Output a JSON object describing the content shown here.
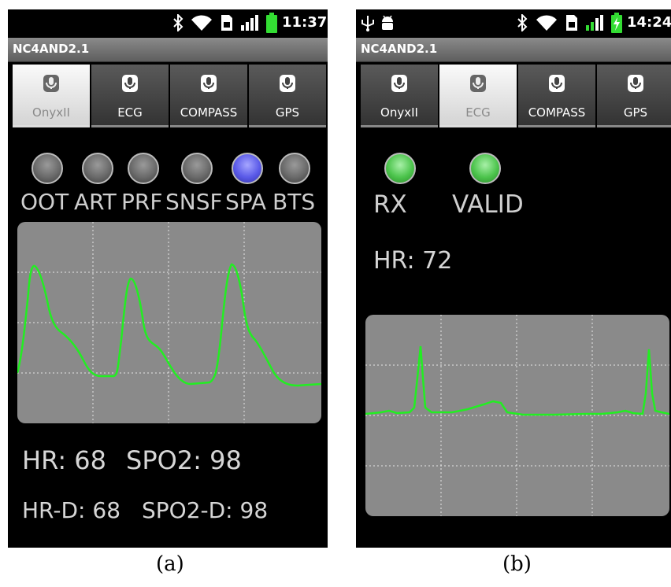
{
  "panel_a": {
    "status": {
      "time": "11:37"
    },
    "app_title": "NC4AND2.1",
    "tabs": [
      {
        "label": "OnyxII",
        "selected": true
      },
      {
        "label": "ECG",
        "selected": false
      },
      {
        "label": "COMPASS",
        "selected": false
      },
      {
        "label": "GPS",
        "selected": false
      }
    ],
    "indicators": [
      {
        "label": "OOT",
        "state": "off"
      },
      {
        "label": "ART",
        "state": "off"
      },
      {
        "label": "PRF",
        "state": "off"
      },
      {
        "label": "SNSF",
        "state": "off"
      },
      {
        "label": "SPA",
        "state": "on"
      },
      {
        "label": "BTS",
        "state": "off"
      }
    ],
    "hr": "HR: 68",
    "spo2": "SPO2: 98",
    "hr_d": "HR-D: 68",
    "spo2_d": "SPO2-D: 98",
    "caption": "(a)"
  },
  "panel_b": {
    "status": {
      "time": "14:24"
    },
    "app_title": "NC4AND2.1",
    "tabs": [
      {
        "label": "OnyxII",
        "selected": false
      },
      {
        "label": "ECG",
        "selected": true
      },
      {
        "label": "COMPASS",
        "selected": false
      },
      {
        "label": "GPS",
        "selected": false
      }
    ],
    "indicators": [
      {
        "label": "RX",
        "state": "on"
      },
      {
        "label": "VALID",
        "state": "on"
      }
    ],
    "hr": "HR: 72",
    "caption": "(b)"
  },
  "colors": {
    "trace": "#22ee22",
    "plot_bg": "#8a8a8a",
    "grid": "#e6e6e6",
    "led_blue": "#5a5ae8",
    "led_green": "#4cc44c",
    "led_gray": "#6a6a6a"
  },
  "icons": [
    "bluetooth-icon",
    "wifi-icon",
    "sim-icon",
    "signal-icon",
    "battery-icon",
    "usb-icon",
    "android-debug-icon",
    "microphone-icon"
  ]
}
